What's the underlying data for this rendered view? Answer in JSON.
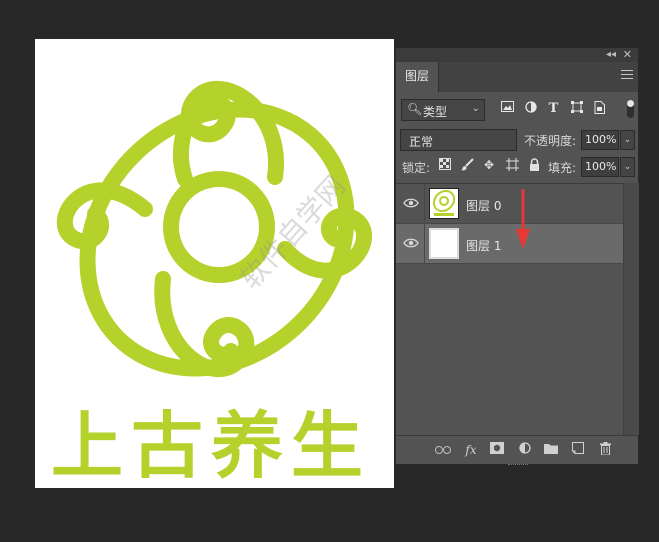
{
  "canvas": {
    "logo_text": "上古养生",
    "logo_color": "#b5d12c",
    "watermark": "软件自学网"
  },
  "panel": {
    "tab": "图层",
    "collapse_icon": "double-chevron-left-icon",
    "close_icon": "close-icon",
    "menu_icon": "hamburger-menu-icon",
    "filter_kind": "类型",
    "filter_icons": [
      "image-icon",
      "adjustment-icon",
      "type-icon",
      "shape-icon",
      "smart-object-icon"
    ],
    "blend_mode": "正常",
    "opacity_label": "不透明度:",
    "opacity_value": "100%",
    "lock_label": "锁定:",
    "lock_icons": [
      "lock-transparent-icon",
      "lock-paint-icon",
      "lock-move-icon",
      "lock-artboard-icon",
      "lock-all-icon"
    ],
    "fill_label": "填充:",
    "fill_value": "100%",
    "layers": [
      {
        "name": "图层 0",
        "visible": true,
        "selected": false
      },
      {
        "name": "图层 1",
        "visible": true,
        "selected": true
      }
    ],
    "bottom_icons": [
      "link-icon",
      "fx-icon",
      "mask-icon",
      "adjustment-layer-icon",
      "group-folder-icon",
      "new-layer-icon",
      "trash-icon"
    ],
    "accent_arrow_color": "#e53935",
    "panel_bg": "#535353"
  }
}
